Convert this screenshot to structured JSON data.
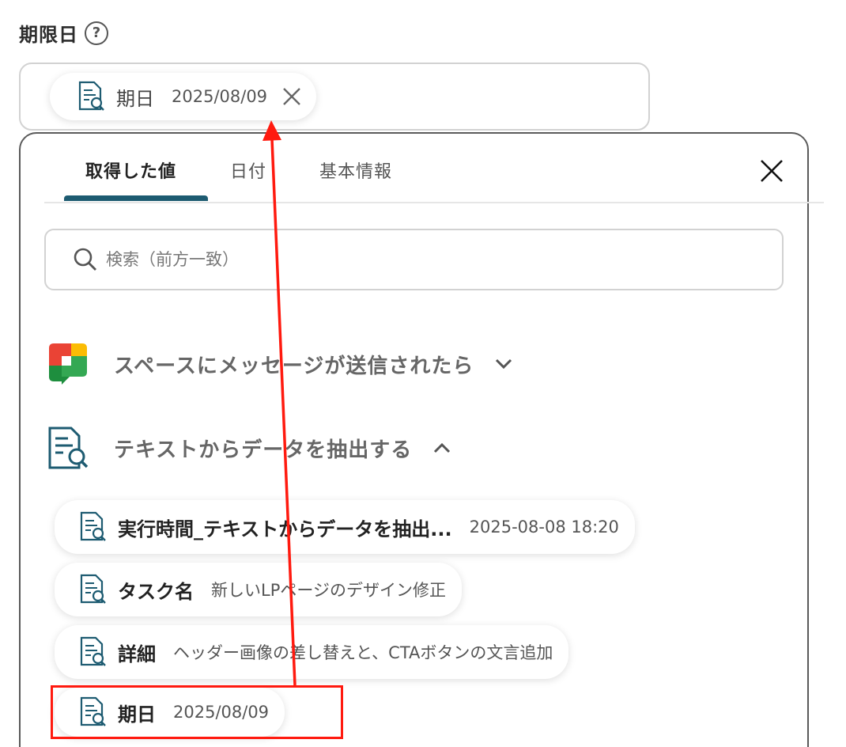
{
  "field": {
    "label": "期限日",
    "help_glyph": "?"
  },
  "selected_chip": {
    "name": "期日",
    "value": "2025/08/09"
  },
  "tabs": [
    {
      "label": "取得した値",
      "active": true
    },
    {
      "label": "日付",
      "active": false
    },
    {
      "label": "基本情報",
      "active": false
    }
  ],
  "search": {
    "placeholder": "検索（前方一致）"
  },
  "sections": [
    {
      "title": "スペースにメッセージが送信されたら",
      "icon": "google-chat-icon",
      "expanded": false
    },
    {
      "title": "テキストからデータを抽出する",
      "icon": "document-search-icon",
      "expanded": true
    }
  ],
  "items": [
    {
      "name": "実行時間_テキストからデータを抽出...",
      "value": "2025-08-08 18:20"
    },
    {
      "name": "タスク名",
      "value": "新しいLPページのデザイン修正"
    },
    {
      "name": "詳細",
      "value": "ヘッダー画像の差し替えと、CTAボタンの文言追加"
    },
    {
      "name": "期日",
      "value": "2025/08/09"
    }
  ],
  "colors": {
    "accent": "#1d5b71",
    "annotation": "#ff1a0f"
  }
}
